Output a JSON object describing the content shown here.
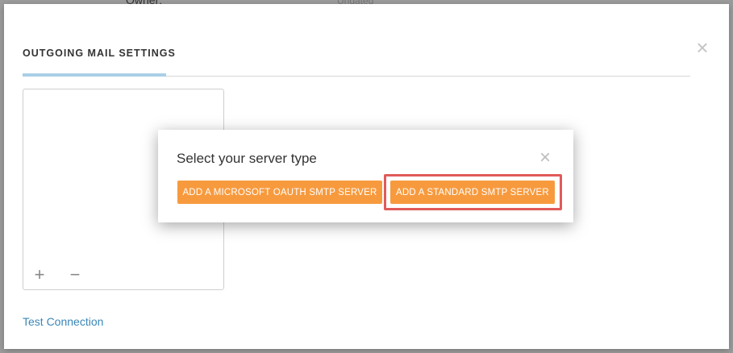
{
  "background": {
    "owner_label": "Owner:",
    "hint_text": "Undated"
  },
  "outer_modal": {
    "tab_title": "OUTGOING MAIL SETTINGS",
    "close_glyph": "×",
    "add_glyph": "+",
    "remove_glyph": "−",
    "test_connection": "Test Connection"
  },
  "dialog": {
    "title": "Select your server type",
    "close_glyph": "×",
    "buttons": [
      {
        "label": "ADD A MICROSOFT OAUTH SMTP SERVER"
      },
      {
        "label": "ADD A STANDARD SMTP SERVER"
      }
    ]
  },
  "colors": {
    "accent_orange": "#f79a3e",
    "highlight_red": "#e15a5a",
    "link_blue": "#3a87b8",
    "tab_underline": "#a9cfe6"
  }
}
